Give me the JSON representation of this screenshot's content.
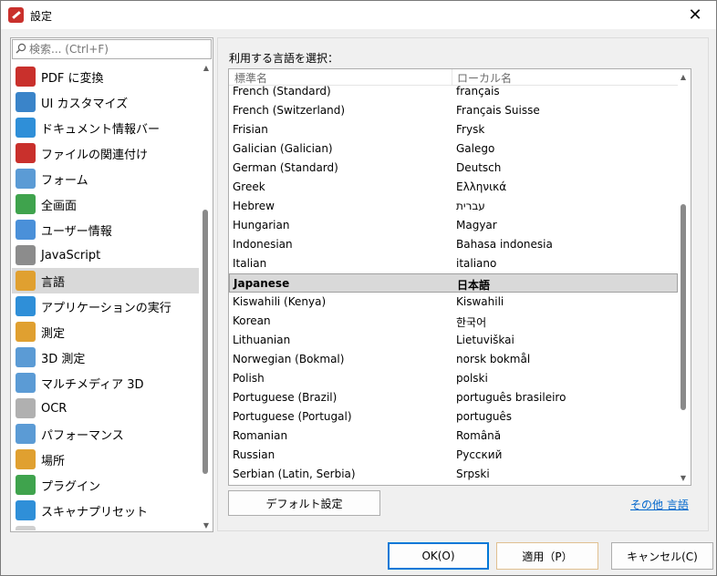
{
  "window": {
    "title": "設定",
    "close_label": "✕"
  },
  "search": {
    "placeholder": "検索... (Ctrl+F)"
  },
  "nav": {
    "items": [
      {
        "label": "PDF に変換",
        "icon": "pdf-convert-icon",
        "color": "#c9302c"
      },
      {
        "label": "UI カスタマイズ",
        "icon": "ui-customize-icon",
        "color": "#3a84c9"
      },
      {
        "label": "ドキュメント情報バー",
        "icon": "info-bar-icon",
        "color": "#2f8fd8"
      },
      {
        "label": "ファイルの関連付け",
        "icon": "file-association-icon",
        "color": "#c9302c"
      },
      {
        "label": "フォーム",
        "icon": "form-icon",
        "color": "#5b9bd5"
      },
      {
        "label": "全画面",
        "icon": "fullscreen-icon",
        "color": "#3fa34d"
      },
      {
        "label": "ユーザー情報",
        "icon": "user-icon",
        "color": "#4a90d9"
      },
      {
        "label": "JavaScript",
        "icon": "javascript-icon",
        "color": "#8c8c8c"
      },
      {
        "label": "言語",
        "icon": "language-icon",
        "color": "#e0a030",
        "selected": true
      },
      {
        "label": "アプリケーションの実行",
        "icon": "run-app-icon",
        "color": "#2f8fd8"
      },
      {
        "label": "測定",
        "icon": "measure-icon",
        "color": "#e0a030"
      },
      {
        "label": "3D 測定",
        "icon": "measure-3d-icon",
        "color": "#5b9bd5"
      },
      {
        "label": "マルチメディア 3D",
        "icon": "multimedia-3d-icon",
        "color": "#5b9bd5"
      },
      {
        "label": "OCR",
        "icon": "ocr-icon",
        "color": "#b0b0b0"
      },
      {
        "label": "パフォーマンス",
        "icon": "performance-icon",
        "color": "#5b9bd5"
      },
      {
        "label": "場所",
        "icon": "location-icon",
        "color": "#e0a030"
      },
      {
        "label": "プラグイン",
        "icon": "plugin-icon",
        "color": "#3fa34d"
      },
      {
        "label": "スキャナプリセット",
        "icon": "scanner-icon",
        "color": "#2f8fd8"
      },
      {
        "label": "",
        "icon": "partial-item-icon",
        "color": "#d0d0d0"
      }
    ]
  },
  "language": {
    "group_label": "利用する言語を選択：",
    "col_standard": "標準名",
    "col_local": "ローカル名",
    "rows": [
      {
        "standard": "French (Standard)",
        "local": "français"
      },
      {
        "standard": "French (Switzerland)",
        "local": "Français Suisse"
      },
      {
        "standard": "Frisian",
        "local": "Frysk"
      },
      {
        "standard": "Galician (Galician)",
        "local": "Galego"
      },
      {
        "standard": "German (Standard)",
        "local": "Deutsch"
      },
      {
        "standard": "Greek",
        "local": "Ελληνικά"
      },
      {
        "standard": "Hebrew",
        "local": "עברית"
      },
      {
        "standard": "Hungarian",
        "local": "Magyar"
      },
      {
        "standard": "Indonesian",
        "local": "Bahasa indonesia"
      },
      {
        "standard": "Italian",
        "local": "italiano"
      },
      {
        "standard": "Japanese",
        "local": "日本語",
        "selected": true
      },
      {
        "standard": "Kiswahili (Kenya)",
        "local": "Kiswahili"
      },
      {
        "standard": "Korean",
        "local": "한국어"
      },
      {
        "standard": "Lithuanian",
        "local": "Lietuviškai"
      },
      {
        "standard": "Norwegian (Bokmal)",
        "local": "norsk bokmål"
      },
      {
        "standard": "Polish",
        "local": "polski"
      },
      {
        "standard": "Portuguese (Brazil)",
        "local": "português brasileiro"
      },
      {
        "standard": "Portuguese (Portugal)",
        "local": "português"
      },
      {
        "standard": "Romanian",
        "local": "Română"
      },
      {
        "standard": "Russian",
        "local": "Русский"
      },
      {
        "standard": "Serbian (Latin, Serbia)",
        "local": "Srpski"
      }
    ],
    "default_button": "デフォルト設定",
    "other_link": "その他 言語"
  },
  "footer": {
    "ok": "OK(O)",
    "apply": "適用（P）",
    "cancel": "キャンセル(C)"
  }
}
